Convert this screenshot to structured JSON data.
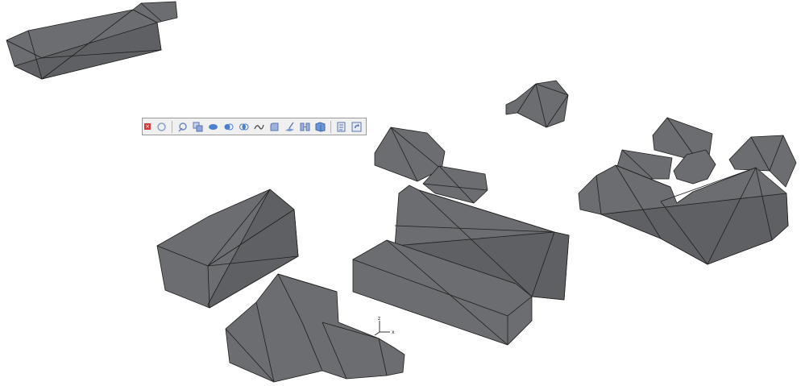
{
  "toolbar": {
    "close_label": "×",
    "tools": [
      {
        "name": "select-tool-icon",
        "color": "#8aa0c8"
      },
      {
        "name": "sketch-tool-icon",
        "color": "#6a86c0"
      },
      {
        "name": "copy-tool-icon",
        "color": "#5a74b0"
      },
      {
        "name": "union-tool-icon",
        "color": "#4a7fd0"
      },
      {
        "name": "subtract-tool-icon",
        "color": "#4a7fd0"
      },
      {
        "name": "intersect-tool-icon",
        "color": "#4a7fd0"
      },
      {
        "name": "curve-tool-icon",
        "color": "#4a4a4a"
      },
      {
        "name": "fillet-tool-icon",
        "color": "#5a74b0"
      },
      {
        "name": "extrude-tool-icon",
        "color": "#5a74b0"
      },
      {
        "name": "split-tool-icon",
        "color": "#5a74b0"
      },
      {
        "name": "box-tool-icon",
        "color": "#3a6ab0"
      },
      {
        "name": "properties-tool-icon",
        "color": "#5a74b0"
      },
      {
        "name": "refresh-tool-icon",
        "color": "#5a74b0"
      }
    ]
  },
  "axis": {
    "x_label": "x",
    "z_label": "z"
  },
  "colors": {
    "mesh_face": "#6b6d70",
    "mesh_face_dark": "#57595c",
    "mesh_edge": "#1e1e1e",
    "background": "#ffffff"
  }
}
